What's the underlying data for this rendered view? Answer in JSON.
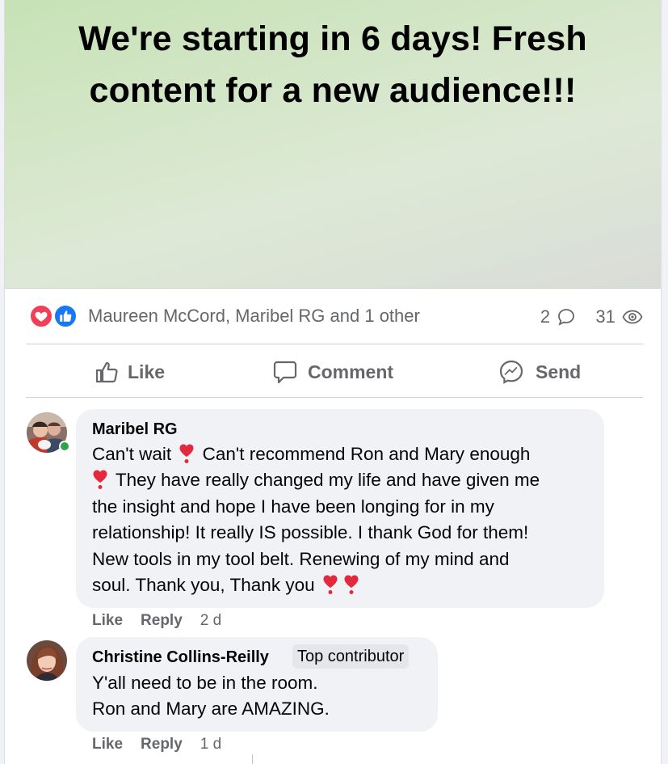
{
  "post": {
    "image_text_line1": "We're starting in 6 days! Fresh",
    "image_text_line2": "content for a new audience!!!"
  },
  "reactions": {
    "reactors": "Maureen McCord, Maribel RG and 1 other",
    "comments_count": "2",
    "views_count": "31",
    "icons": [
      "love-reaction-icon",
      "like-reaction-icon",
      "comment-icon",
      "eye-icon"
    ]
  },
  "actions": {
    "like_label": "Like",
    "comment_label": "Comment",
    "send_label": "Send"
  },
  "comments": [
    {
      "author": "Maribel RG",
      "text_parts": [
        "Can't wait",
        "Can't recommend Ron and Mary enough",
        "They have really changed my life and have given me",
        "the insight and hope I have been longing for in my",
        "relationship! It really IS possible. I thank God for them!",
        "New tools in my tool belt. Renewing of my mind and",
        "soul. Thank you, Thank you"
      ],
      "like_label": "Like",
      "reply_label": "Reply",
      "time": "2 d"
    },
    {
      "author": "Christine Collins-Reilly",
      "badge": "Top contributor",
      "text_line1": "Y'all need to be in the room.",
      "text_line2": "Ron and Mary are AMAZING.",
      "like_label": "Like",
      "reply_label": "Reply",
      "time": "1 d"
    }
  ],
  "colors": {
    "love": "#f33e58",
    "like": "#1877f2",
    "secondary_text": "#65676b",
    "bubble": "#f0f2f5",
    "online": "#31a24c"
  }
}
